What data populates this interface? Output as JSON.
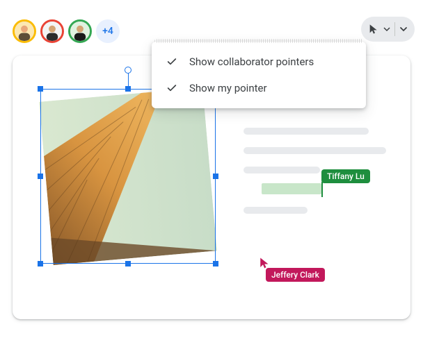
{
  "collaborators": {
    "more_count": "+4"
  },
  "menu": {
    "item1": "Show collaborator pointers",
    "item2": "Show my pointer"
  },
  "cursors": {
    "tiffany": "Tiffany Lu",
    "jeffery": "Jeffery Clark"
  },
  "colors": {
    "tiffany": "#1e8e3e",
    "jeffery": "#c2185b",
    "selection": "#1a73e8"
  }
}
